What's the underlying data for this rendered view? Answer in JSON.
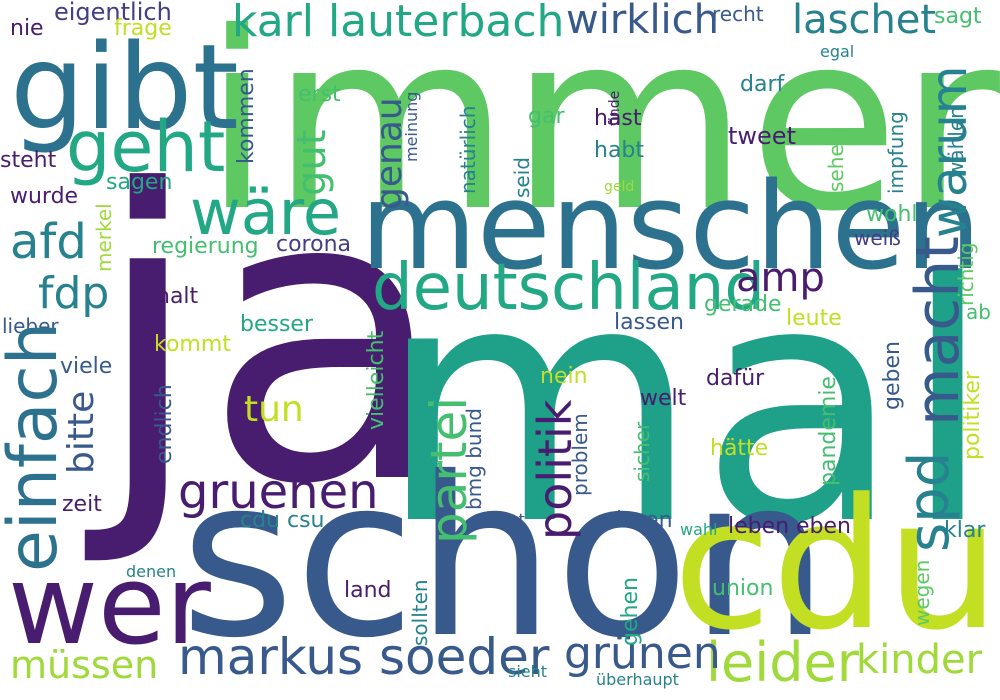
{
  "palette": {
    "deep_purple": "#481c6e",
    "indigo": "#433e85",
    "blue": "#38598c",
    "steel": "#2c728e",
    "teal": "#26828e",
    "teal_green": "#1fa088",
    "green": "#22a884",
    "mid_green": "#44bf70",
    "light_green": "#5ec962",
    "lime": "#9fda3a",
    "yellow_green": "#c2df23"
  },
  "words": [
    {
      "text": "ja",
      "color": "deep_purple"
    },
    {
      "text": "mal",
      "color": "teal_green"
    },
    {
      "text": "immer",
      "color": "light_green"
    },
    {
      "text": "schon",
      "color": "blue"
    },
    {
      "text": "cdu",
      "color": "yellow_green"
    },
    {
      "text": "menschen",
      "color": "steel"
    },
    {
      "text": "gibt",
      "color": "steel"
    },
    {
      "text": "wer",
      "color": "deep_purple"
    },
    {
      "text": "deutschland",
      "color": "green"
    },
    {
      "text": "geht",
      "color": "green"
    },
    {
      "text": "einfach",
      "color": "steel"
    },
    {
      "text": "macht",
      "color": "blue"
    },
    {
      "text": "markus soeder",
      "color": "blue"
    },
    {
      "text": "politik",
      "color": "deep_purple"
    },
    {
      "text": "partei",
      "color": "mid_green"
    },
    {
      "text": "spd",
      "color": "teal"
    },
    {
      "text": "wäre",
      "color": "green"
    },
    {
      "text": "warum",
      "color": "teal"
    },
    {
      "text": "karl lauterbach",
      "color": "green"
    },
    {
      "text": "gruenen",
      "color": "deep_purple"
    },
    {
      "text": "leider",
      "color": "lime"
    },
    {
      "text": "grünen",
      "color": "blue"
    },
    {
      "text": "wirklich",
      "color": "blue"
    },
    {
      "text": "laschet",
      "color": "teal"
    },
    {
      "text": "afd",
      "color": "teal"
    },
    {
      "text": "fdp",
      "color": "teal"
    },
    {
      "text": "müssen",
      "color": "lime"
    },
    {
      "text": "kinder",
      "color": "lime"
    },
    {
      "text": "amp",
      "color": "deep_purple"
    },
    {
      "text": "gut",
      "color": "mid_green"
    },
    {
      "text": "genau",
      "color": "blue"
    },
    {
      "text": "bitte",
      "color": "blue"
    },
    {
      "text": "tun",
      "color": "yellow_green"
    },
    {
      "text": "eigentlich",
      "color": "indigo"
    },
    {
      "text": "frage",
      "color": "yellow_green"
    },
    {
      "text": "nie",
      "color": "deep_purple"
    },
    {
      "text": "recht",
      "color": "blue"
    },
    {
      "text": "sagt",
      "color": "mid_green"
    },
    {
      "text": "egal",
      "color": "teal"
    },
    {
      "text": "steht",
      "color": "deep_purple"
    },
    {
      "text": "sagen",
      "color": "green"
    },
    {
      "text": "wurde",
      "color": "deep_purple"
    },
    {
      "text": "kommen",
      "color": "blue"
    },
    {
      "text": "erst",
      "color": "mid_green"
    },
    {
      "text": "meinung",
      "color": "blue"
    },
    {
      "text": "natürlich",
      "color": "teal"
    },
    {
      "text": "gar",
      "color": "mid_green"
    },
    {
      "text": "finde",
      "color": "deep_purple"
    },
    {
      "text": "hast",
      "color": "deep_purple"
    },
    {
      "text": "habt",
      "color": "teal"
    },
    {
      "text": "darf",
      "color": "teal"
    },
    {
      "text": "tweet",
      "color": "deep_purple"
    },
    {
      "text": "sehen",
      "color": "light_green"
    },
    {
      "text": "impfung",
      "color": "teal"
    },
    {
      "text": "wählen",
      "color": "teal"
    },
    {
      "text": "seid",
      "color": "teal"
    },
    {
      "text": "geld",
      "color": "lime"
    },
    {
      "text": "wohl",
      "color": "mid_green"
    },
    {
      "text": "weiß",
      "color": "indigo"
    },
    {
      "text": "richtig",
      "color": "light_green"
    },
    {
      "text": "merkel",
      "color": "lime"
    },
    {
      "text": "regierung",
      "color": "mid_green"
    },
    {
      "text": "corona",
      "color": "indigo"
    },
    {
      "text": "halt",
      "color": "deep_purple"
    },
    {
      "text": "lieber",
      "color": "blue"
    },
    {
      "text": "besser",
      "color": "green"
    },
    {
      "text": "kommt",
      "color": "yellow_green"
    },
    {
      "text": "viele",
      "color": "blue"
    },
    {
      "text": "gerade",
      "color": "mid_green"
    },
    {
      "text": "leute",
      "color": "yellow_green"
    },
    {
      "text": "lassen",
      "color": "blue"
    },
    {
      "text": "ab",
      "color": "mid_green"
    },
    {
      "text": "nein",
      "color": "yellow_green"
    },
    {
      "text": "vielleicht",
      "color": "mid_green"
    },
    {
      "text": "endlich",
      "color": "blue"
    },
    {
      "text": "welt",
      "color": "deep_purple"
    },
    {
      "text": "dafür",
      "color": "deep_purple"
    },
    {
      "text": "geben",
      "color": "blue"
    },
    {
      "text": "politiker",
      "color": "yellow_green"
    },
    {
      "text": "pandemie",
      "color": "mid_green"
    },
    {
      "text": "hätte",
      "color": "yellow_green"
    },
    {
      "text": "sicher",
      "color": "mid_green"
    },
    {
      "text": "problem",
      "color": "blue"
    },
    {
      "text": "bmg bund",
      "color": "blue"
    },
    {
      "text": "zeit",
      "color": "deep_purple"
    },
    {
      "text": "angst",
      "color": "blue"
    },
    {
      "text": "wissen",
      "color": "blue"
    },
    {
      "text": "wahl",
      "color": "green"
    },
    {
      "text": "leben",
      "color": "deep_purple"
    },
    {
      "text": "eben",
      "color": "deep_purple"
    },
    {
      "text": "klar",
      "color": "teal"
    },
    {
      "text": "cdu csu",
      "color": "teal"
    },
    {
      "text": "denen",
      "color": "teal"
    },
    {
      "text": "land",
      "color": "deep_purple"
    },
    {
      "text": "sollten",
      "color": "teal"
    },
    {
      "text": "gehen",
      "color": "green"
    },
    {
      "text": "union",
      "color": "mid_green"
    },
    {
      "text": "wegen",
      "color": "light_green"
    },
    {
      "text": "sieht",
      "color": "teal"
    },
    {
      "text": "überhaupt",
      "color": "teal"
    }
  ]
}
